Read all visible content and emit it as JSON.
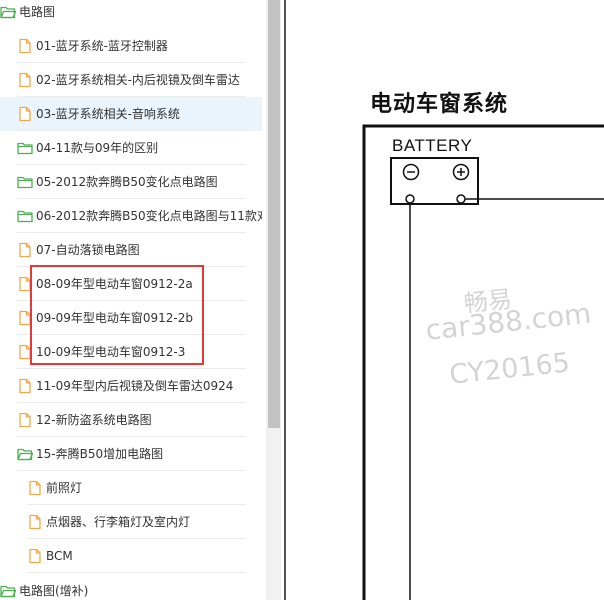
{
  "sidebar": {
    "root_top": {
      "label": "电路图"
    },
    "items": [
      {
        "label": "01-蓝牙系统-蓝牙控制器",
        "icon": "file-icon"
      },
      {
        "label": "02-蓝牙系统相关-内后视镜及倒车雷达",
        "icon": "file-icon"
      },
      {
        "label": "03-蓝牙系统相关-音响系统",
        "icon": "file-icon",
        "selected": true
      },
      {
        "label": "04-11款与09年的区别",
        "icon": "folder-icon"
      },
      {
        "label": "05-2012款奔腾B50变化点电路图",
        "icon": "folder-icon"
      },
      {
        "label": "06-2012款奔腾B50变化点电路图与11款对",
        "icon": "folder-icon"
      },
      {
        "label": "07-自动落锁电路图",
        "icon": "file-icon"
      },
      {
        "label": "08-09年型电动车窗0912-2a",
        "icon": "file-icon"
      },
      {
        "label": "09-09年型电动车窗0912-2b",
        "icon": "file-icon"
      },
      {
        "label": "10-09年型电动车窗0912-3",
        "icon": "file-icon"
      },
      {
        "label": "11-09年型内后视镜及倒车雷达0924",
        "icon": "file-icon"
      },
      {
        "label": "12-新防盗系统电路图",
        "icon": "file-icon"
      },
      {
        "label": "15-奔腾B50增加电路图",
        "icon": "folder-open-icon"
      }
    ],
    "children": [
      {
        "label": "前照灯",
        "icon": "file-icon"
      },
      {
        "label": "点烟器、行李箱灯及室内灯",
        "icon": "file-icon"
      },
      {
        "label": "BCM",
        "icon": "file-icon"
      }
    ],
    "root_bottom": {
      "label": "电路图(增补)"
    }
  },
  "viewer": {
    "title": "电动车窗系统",
    "battery_label": "BATTERY",
    "battery_minus": "−",
    "battery_plus": "+",
    "watermark": {
      "line1": "畅易",
      "line2": "car388.com",
      "line3": "CY20165"
    }
  },
  "colors": {
    "highlight": "#e53935",
    "file_icon": "#f0a84a",
    "folder_icon": "#4caf50",
    "selected_bg": "#eaf4fc"
  }
}
